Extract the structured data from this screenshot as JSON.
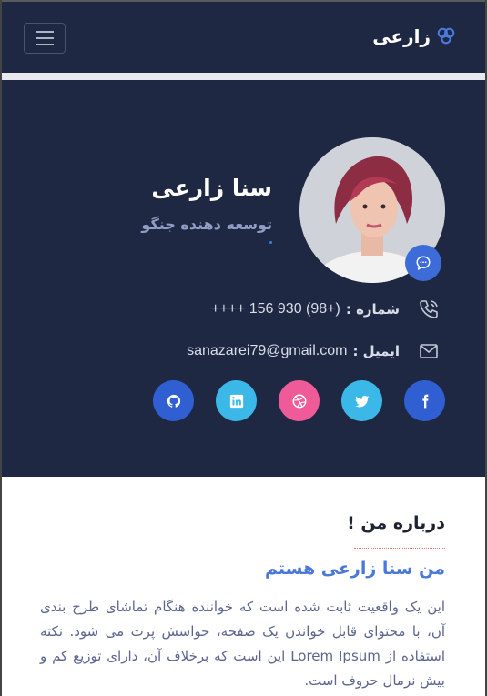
{
  "navbar": {
    "brand": "زارعی",
    "brand_icon": "link-circles-icon",
    "menu_icon": "hamburger-icon",
    "bg_color": "#1f2843",
    "accent_color": "#3d6bd8"
  },
  "profile": {
    "name": "سنا زارعی",
    "role": "توسعه دهنده جنگو",
    "avatar_icon": "profile-photo",
    "message_icon": "chat-bubble-icon"
  },
  "contact": {
    "phone": {
      "label": "شماره :",
      "value": "++++ 156 930 (98+)",
      "icon": "phone-icon"
    },
    "email": {
      "label": "ایمیل :",
      "value": "sanazarei79@gmail.com",
      "icon": "mail-icon"
    }
  },
  "socials": [
    {
      "name": "facebook",
      "icon": "facebook-icon",
      "color": "#2f5fd0"
    },
    {
      "name": "twitter",
      "icon": "twitter-icon",
      "color": "#3bb8e8"
    },
    {
      "name": "dribbble",
      "icon": "dribbble-icon",
      "color": "#ef5a98"
    },
    {
      "name": "linkedin",
      "icon": "linkedin-icon",
      "color": "#3bb8e8"
    },
    {
      "name": "github",
      "icon": "github-icon",
      "color": "#2f5fd0"
    }
  ],
  "about": {
    "heading": "درباره من !",
    "subtitle": "من سنا زارعی هستم",
    "body": "این یک واقعیت ثابت شده است که خواننده هنگام تماشای طرح بندی آن، با محتوای قابل خواندن یک صفحه، حواسش پرت می شود. نکته استفاده از Lorem Ipsum این است که برخلاف آن، دارای توزیع کم و بیش نرمال حروف است."
  }
}
